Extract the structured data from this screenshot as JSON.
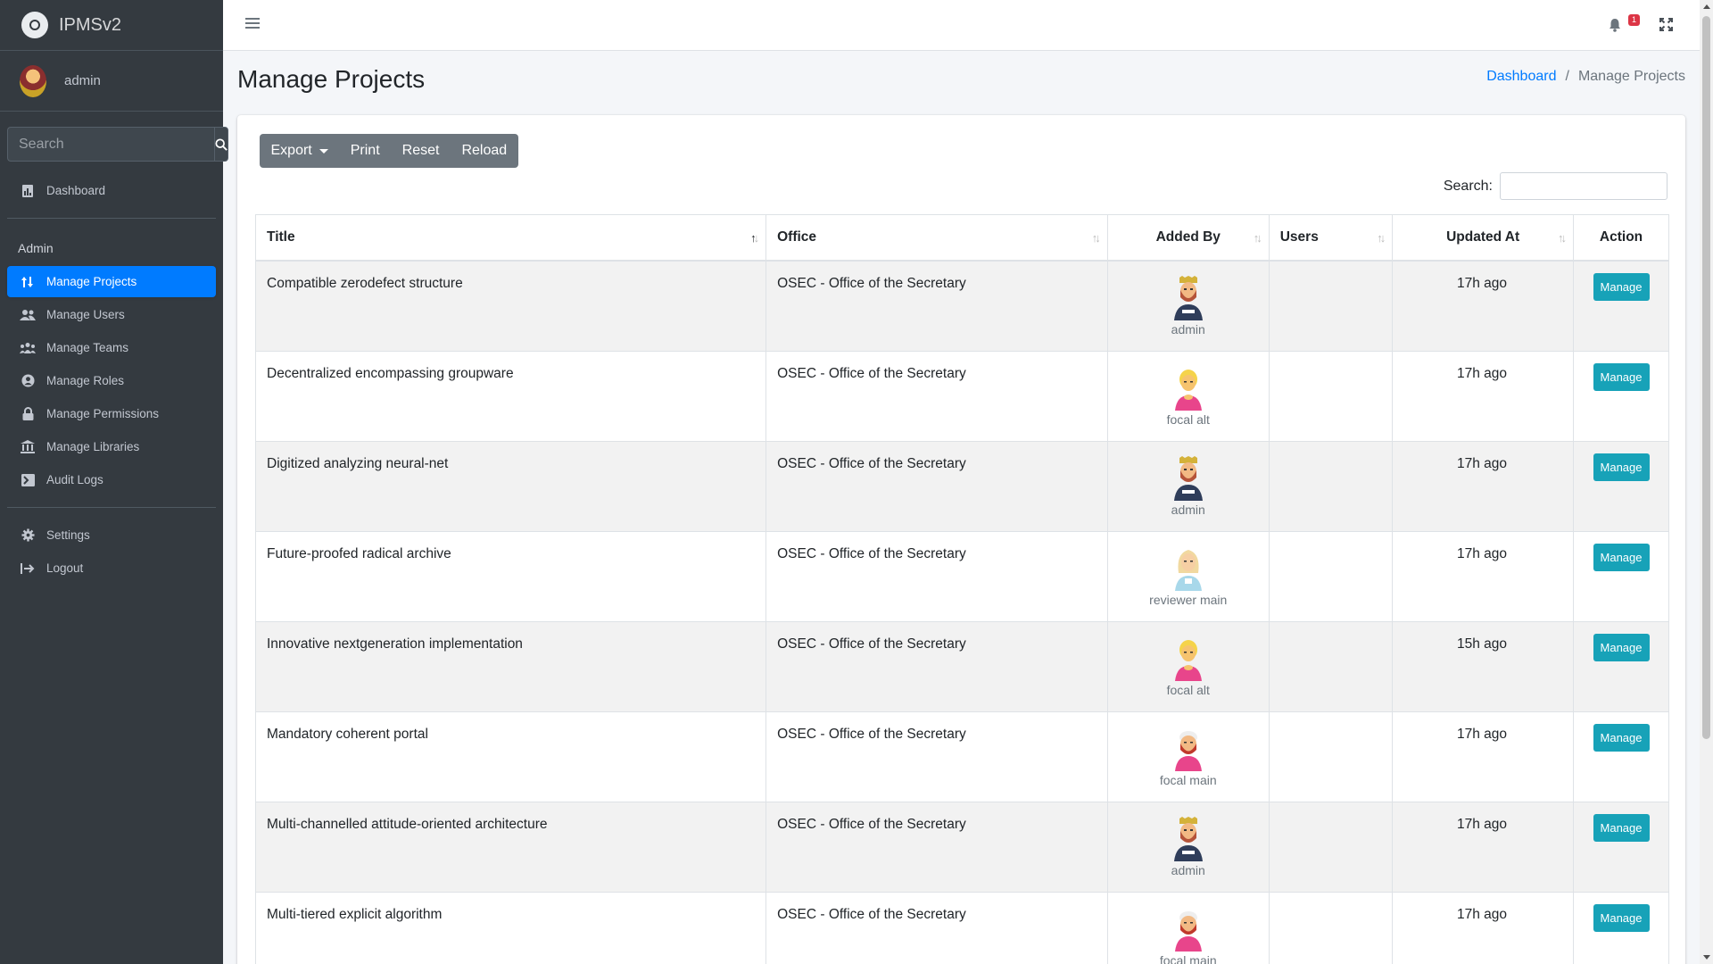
{
  "brand": {
    "logo_text": "IPMSv2",
    "name": "IPMSv2"
  },
  "user": {
    "name": "admin"
  },
  "sidebar": {
    "search_placeholder": "Search",
    "dashboard": {
      "label": "Dashboard",
      "icon": "dashboard-icon"
    },
    "section_header": "Admin",
    "items": [
      {
        "label": "Manage Projects",
        "icon": "sort-arrows-icon",
        "active": true
      },
      {
        "label": "Manage Users",
        "icon": "users-icon"
      },
      {
        "label": "Manage Teams",
        "icon": "teams-icon"
      },
      {
        "label": "Manage Roles",
        "icon": "user-circle-icon"
      },
      {
        "label": "Manage Permissions",
        "icon": "lock-icon"
      },
      {
        "label": "Manage Libraries",
        "icon": "library-icon"
      },
      {
        "label": "Audit Logs",
        "icon": "terminal-icon"
      }
    ],
    "settings": {
      "label": "Settings",
      "icon": "gear-icon"
    },
    "logout": {
      "label": "Logout",
      "icon": "logout-icon"
    }
  },
  "topbar": {
    "notification_count": "1"
  },
  "page": {
    "title": "Manage Projects",
    "breadcrumb": {
      "home": "Dashboard",
      "current": "Manage Projects"
    }
  },
  "toolbar": {
    "export": "Export",
    "print": "Print",
    "reset": "Reset",
    "reload": "Reload"
  },
  "table_search": {
    "label": "Search:"
  },
  "table": {
    "headers": {
      "title": "Title",
      "office": "Office",
      "added_by": "Added By",
      "users": "Users",
      "updated_at": "Updated At",
      "action": "Action"
    },
    "rows": [
      {
        "title": "Compatible zerodefect structure",
        "office": "OSEC - Office of the Secretary",
        "added_by": "admin",
        "avatar": "admin",
        "users": "",
        "updated_at": "17h ago",
        "action": "Manage"
      },
      {
        "title": "Decentralized encompassing groupware",
        "office": "OSEC - Office of the Secretary",
        "added_by": "focal alt",
        "avatar": "focal-alt",
        "users": "",
        "updated_at": "17h ago",
        "action": "Manage"
      },
      {
        "title": "Digitized analyzing neural-net",
        "office": "OSEC - Office of the Secretary",
        "added_by": "admin",
        "avatar": "admin",
        "users": "",
        "updated_at": "17h ago",
        "action": "Manage"
      },
      {
        "title": "Future-proofed radical archive",
        "office": "OSEC - Office of the Secretary",
        "added_by": "reviewer main",
        "avatar": "reviewer-main",
        "users": "",
        "updated_at": "17h ago",
        "action": "Manage"
      },
      {
        "title": "Innovative nextgeneration implementation",
        "office": "OSEC - Office of the Secretary",
        "added_by": "focal alt",
        "avatar": "focal-alt",
        "users": "",
        "updated_at": "15h ago",
        "action": "Manage"
      },
      {
        "title": "Mandatory coherent portal",
        "office": "OSEC - Office of the Secretary",
        "added_by": "focal main",
        "avatar": "focal-main",
        "users": "",
        "updated_at": "17h ago",
        "action": "Manage"
      },
      {
        "title": "Multi-channelled attitude-oriented architecture",
        "office": "OSEC - Office of the Secretary",
        "added_by": "admin",
        "avatar": "admin",
        "users": "",
        "updated_at": "17h ago",
        "action": "Manage"
      },
      {
        "title": "Multi-tiered explicit algorithm",
        "office": "OSEC - Office of the Secretary",
        "added_by": "focal main",
        "avatar": "focal-main",
        "users": "",
        "updated_at": "17h ago",
        "action": "Manage"
      }
    ]
  },
  "colors": {
    "sidebar_bg": "#343a40",
    "primary": "#007bff",
    "info": "#17a2b8",
    "secondary": "#6c757d",
    "danger": "#dc3545"
  }
}
